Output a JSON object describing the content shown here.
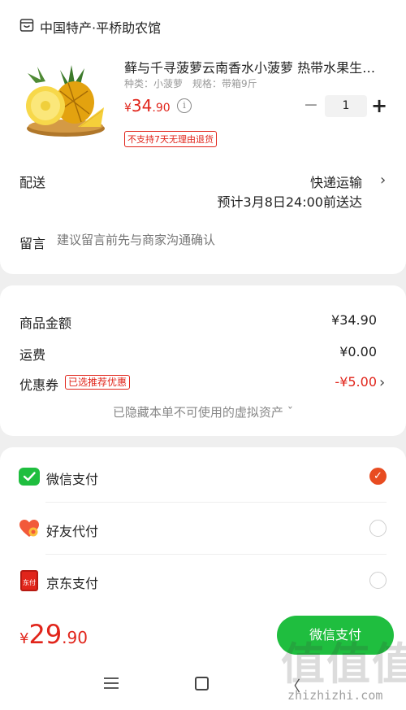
{
  "shop": {
    "name": "中国特产·平桥助农馆",
    "icon": "shop-icon"
  },
  "product": {
    "title": "藓与千寻菠萝云南香水小菠萝 热带水果生…",
    "spec_type": "种类：小菠萝",
    "spec_size": "规格：带箱9斤",
    "price_currency": "¥",
    "price_int": "34",
    "price_dec": ".90",
    "info_icon_glyph": "i",
    "minus": "−",
    "quantity": "1",
    "plus": "+",
    "return_policy": "不支持7天无理由退货"
  },
  "delivery": {
    "label": "配送",
    "method": "快递运输",
    "eta": "预计3月8日24:00前送达",
    "chevron": "›"
  },
  "note": {
    "label": "留言",
    "placeholder": "建议留言前先与商家沟通确认"
  },
  "amounts": {
    "goods_label": "商品金额",
    "goods_value": "¥34.90",
    "shipping_label": "运费",
    "shipping_value": "¥0.00",
    "coupon_label": "优惠券",
    "coupon_badge": "已选推荐优惠",
    "coupon_value": "-¥5.00",
    "coupon_chevron": "›",
    "hidden_assets": "已隐藏本单不可使用的虚拟资产 ˇ"
  },
  "payment": {
    "methods": [
      {
        "label": "微信支付",
        "icon": "wechat-pay-icon",
        "selected": true
      },
      {
        "label": "好友代付",
        "icon": "friend-pay-icon",
        "selected": false
      },
      {
        "label": "京东支付",
        "icon": "jd-pay-icon",
        "selected": false
      }
    ],
    "jd_icon_text": "东付",
    "check_glyph": "✓"
  },
  "footer": {
    "total_currency": "¥",
    "total_int": "29",
    "total_dec": ".90",
    "pay_button": "微信支付"
  },
  "system_nav": {
    "back_glyph": "〈"
  },
  "watermark": {
    "logo_text": "值值值",
    "url": "zhizhizhi.com"
  },
  "colors": {
    "price_red": "#e1251b",
    "wechat_green": "#1fbe3f",
    "selected_orange": "#e84c21",
    "background": "#efefef"
  }
}
